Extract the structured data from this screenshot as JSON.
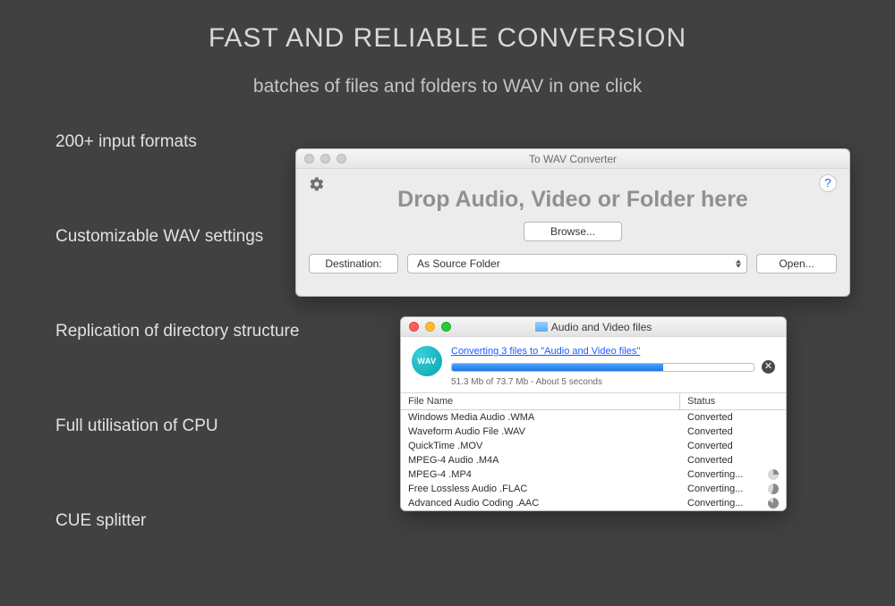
{
  "heading": "FAST AND RELIABLE CONVERSION",
  "subheading": "batches of files and folders to WAV in one click",
  "features": [
    "200+ input formats",
    "Customizable WAV settings",
    "Replication of directory structure",
    "Full utilisation of CPU",
    "CUE splitter"
  ],
  "drop_window": {
    "title": "To WAV Converter",
    "drop_text": "Drop Audio, Video or Folder here",
    "browse": "Browse...",
    "destination_label": "Destination:",
    "destination_value": "As Source Folder",
    "open": "Open...",
    "help": "?"
  },
  "progress_window": {
    "title": "Audio and Video files",
    "badge_text": "WAV",
    "link": "Converting 3 files to \"Audio and Video files\"",
    "progress_percent": 70,
    "progress_sub": "51.3 Mb of 73.7 Mb - About 5 seconds",
    "cancel": "✕",
    "columns": {
      "file": "File Name",
      "status": "Status"
    },
    "rows": [
      {
        "file": "Windows Media Audio .WMA",
        "status": "Converted",
        "spin": null
      },
      {
        "file": "Waveform Audio File .WAV",
        "status": "Converted",
        "spin": null
      },
      {
        "file": "QuickTime .MOV",
        "status": "Converted",
        "spin": null
      },
      {
        "file": "MPEG-4 Audio .M4A",
        "status": "Converted",
        "spin": null
      },
      {
        "file": "MPEG-4 .MP4",
        "status": "Converting...",
        "spin": "s1"
      },
      {
        "file": "Free Lossless Audio .FLAC",
        "status": "Converting...",
        "spin": "s2"
      },
      {
        "file": "Advanced Audio Coding .AAC",
        "status": "Converting...",
        "spin": "s3"
      }
    ]
  }
}
